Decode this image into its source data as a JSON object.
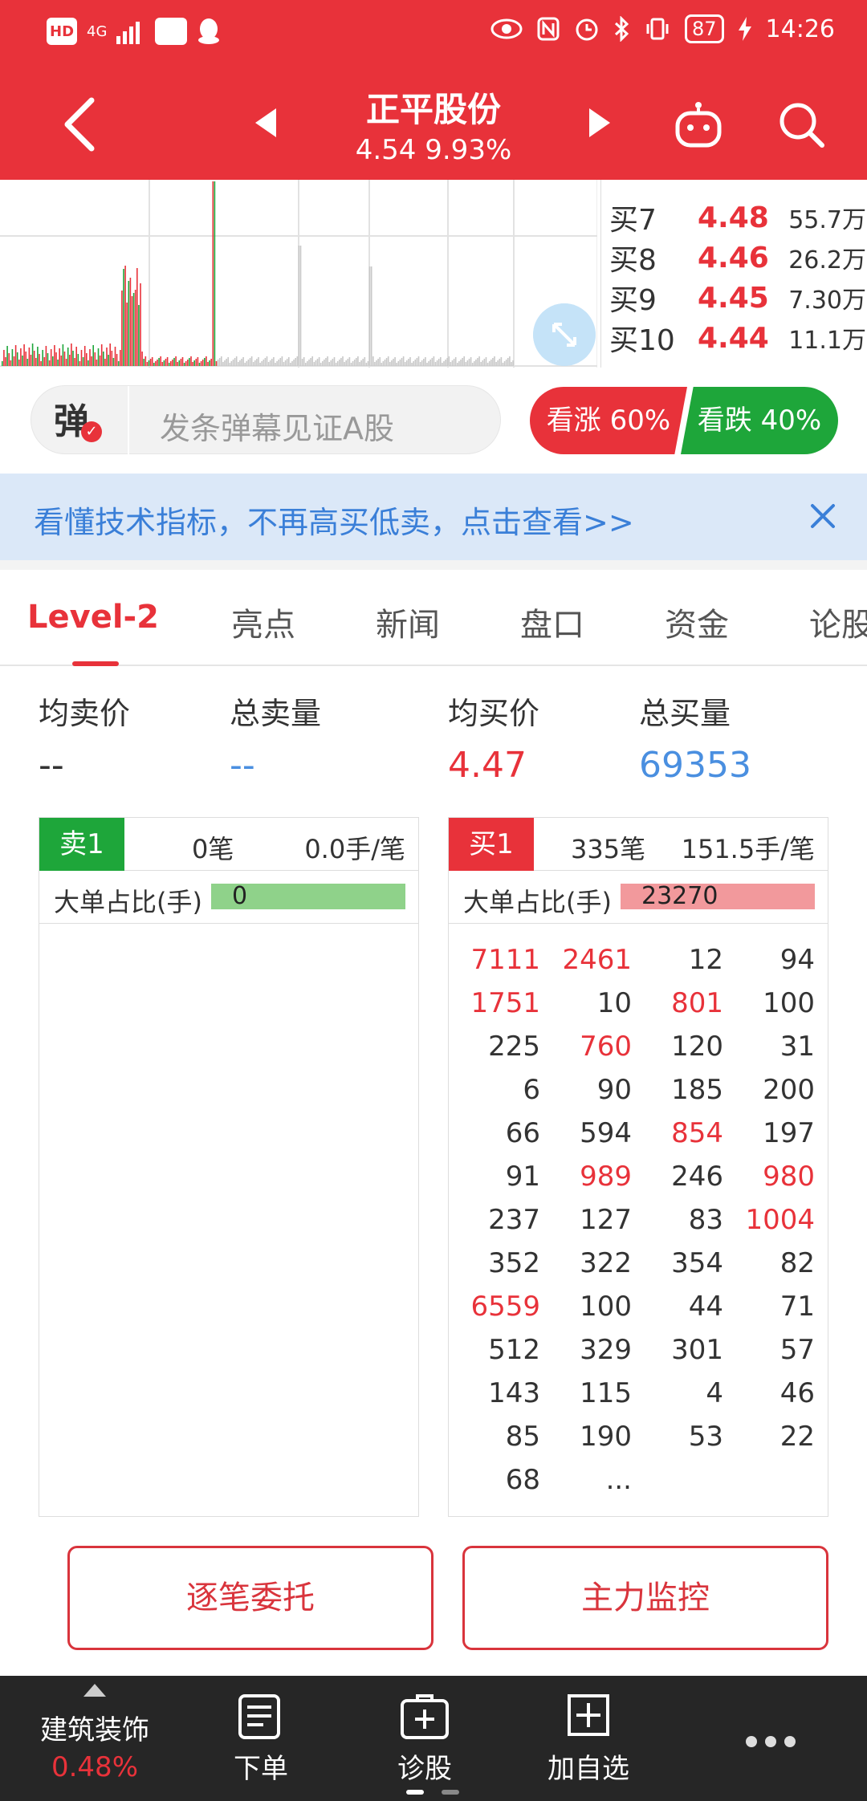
{
  "status_bar": {
    "left_icons": [
      "HD",
      "4G",
      "signal-icon",
      "app-icon",
      "qq-icon"
    ],
    "battery": "87",
    "time": "14:26"
  },
  "header": {
    "title": "正平股份",
    "price": "4.54",
    "change_pct": "9.93%",
    "subtitle": "4.54  9.93%"
  },
  "mini_orderbook": [
    {
      "label": "买7",
      "price": "4.48",
      "volume": "55.7万"
    },
    {
      "label": "买8",
      "price": "4.46",
      "volume": "26.2万"
    },
    {
      "label": "买9",
      "price": "4.45",
      "volume": "7.30万"
    },
    {
      "label": "买10",
      "price": "4.44",
      "volume": "11.1万"
    }
  ],
  "danmu": {
    "icon_text": "弹",
    "placeholder": "发条弹幕见证A股",
    "vote_up": "看涨 60%",
    "vote_down": "看跌 40%",
    "vote_up_pct": 60,
    "vote_down_pct": 40
  },
  "banner": {
    "text": "看懂技术指标，不再高买低卖，点击查看>>"
  },
  "tabs": [
    {
      "label": "Level-2",
      "active": true
    },
    {
      "label": "亮点",
      "active": false
    },
    {
      "label": "新闻",
      "active": false
    },
    {
      "label": "盘口",
      "active": false
    },
    {
      "label": "资金",
      "active": false
    },
    {
      "label": "论股",
      "active": false
    }
  ],
  "summary": {
    "avg_sell_label": "均卖价",
    "avg_sell_value": "--",
    "total_sell_label": "总卖量",
    "total_sell_value": "--",
    "avg_buy_label": "均买价",
    "avg_buy_value": "4.47",
    "total_buy_label": "总买量",
    "total_buy_value": "69353"
  },
  "sell_panel": {
    "badge": "卖1",
    "count": "0笔",
    "per": "0.0手/笔",
    "ratio_label": "大单占比(手)",
    "ratio_value": "0"
  },
  "buy_panel": {
    "badge": "买1",
    "count": "335笔",
    "per": "151.5手/笔",
    "ratio_label": "大单占比(手)",
    "ratio_value": "23270",
    "grid": [
      [
        {
          "v": "7111",
          "big": true
        },
        {
          "v": "2461",
          "big": true
        },
        {
          "v": "12",
          "big": false
        },
        {
          "v": "94",
          "big": false
        }
      ],
      [
        {
          "v": "1751",
          "big": true
        },
        {
          "v": "10",
          "big": false
        },
        {
          "v": "801",
          "big": true
        },
        {
          "v": "100",
          "big": false
        }
      ],
      [
        {
          "v": "225",
          "big": false
        },
        {
          "v": "760",
          "big": true
        },
        {
          "v": "120",
          "big": false
        },
        {
          "v": "31",
          "big": false
        }
      ],
      [
        {
          "v": "6",
          "big": false
        },
        {
          "v": "90",
          "big": false
        },
        {
          "v": "185",
          "big": false
        },
        {
          "v": "200",
          "big": false
        }
      ],
      [
        {
          "v": "66",
          "big": false
        },
        {
          "v": "594",
          "big": false
        },
        {
          "v": "854",
          "big": true
        },
        {
          "v": "197",
          "big": false
        }
      ],
      [
        {
          "v": "91",
          "big": false
        },
        {
          "v": "989",
          "big": true
        },
        {
          "v": "246",
          "big": false
        },
        {
          "v": "980",
          "big": true
        }
      ],
      [
        {
          "v": "237",
          "big": false
        },
        {
          "v": "127",
          "big": false
        },
        {
          "v": "83",
          "big": false
        },
        {
          "v": "1004",
          "big": true
        }
      ],
      [
        {
          "v": "352",
          "big": false
        },
        {
          "v": "322",
          "big": false
        },
        {
          "v": "354",
          "big": false
        },
        {
          "v": "82",
          "big": false
        }
      ],
      [
        {
          "v": "6559",
          "big": true
        },
        {
          "v": "100",
          "big": false
        },
        {
          "v": "44",
          "big": false
        },
        {
          "v": "71",
          "big": false
        }
      ],
      [
        {
          "v": "512",
          "big": false
        },
        {
          "v": "329",
          "big": false
        },
        {
          "v": "301",
          "big": false
        },
        {
          "v": "57",
          "big": false
        }
      ],
      [
        {
          "v": "143",
          "big": false
        },
        {
          "v": "115",
          "big": false
        },
        {
          "v": "4",
          "big": false
        },
        {
          "v": "46",
          "big": false
        }
      ],
      [
        {
          "v": "85",
          "big": false
        },
        {
          "v": "190",
          "big": false
        },
        {
          "v": "53",
          "big": false
        },
        {
          "v": "22",
          "big": false
        }
      ],
      [
        {
          "v": "68",
          "big": false
        },
        {
          "v": "...",
          "big": false
        },
        {
          "v": "",
          "big": false
        },
        {
          "v": "",
          "big": false
        }
      ]
    ]
  },
  "actions": {
    "left": "逐笔委托",
    "right": "主力监控"
  },
  "bottom_bar": {
    "sector_name": "建筑装饰",
    "sector_change": "0.48%",
    "order": "下单",
    "diagnose": "诊股",
    "add_watch": "加自选"
  },
  "colors": {
    "brand_red": "#e8323a",
    "green": "#1ea63a",
    "blue_link": "#4a8fe0"
  }
}
